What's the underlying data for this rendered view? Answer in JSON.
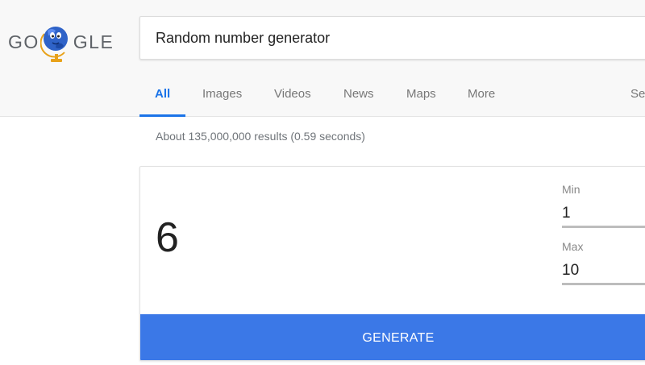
{
  "logo": {
    "left_text": "GO",
    "right_text": "GLE"
  },
  "search": {
    "query": "Random number generator"
  },
  "tabs": [
    {
      "label": "All",
      "active": true
    },
    {
      "label": "Images"
    },
    {
      "label": "Videos"
    },
    {
      "label": "News"
    },
    {
      "label": "Maps"
    },
    {
      "label": "More"
    },
    {
      "label": "Se"
    }
  ],
  "results_stats": "About 135,000,000 results (0.59 seconds)",
  "rng": {
    "result": "6",
    "min_label": "Min",
    "min_value": "1",
    "max_label": "Max",
    "max_value": "10",
    "generate_label": "GENERATE"
  },
  "colors": {
    "accent": "#1a73e8",
    "generate_button": "#3b78e7",
    "header_bg": "#f8f8f8"
  }
}
